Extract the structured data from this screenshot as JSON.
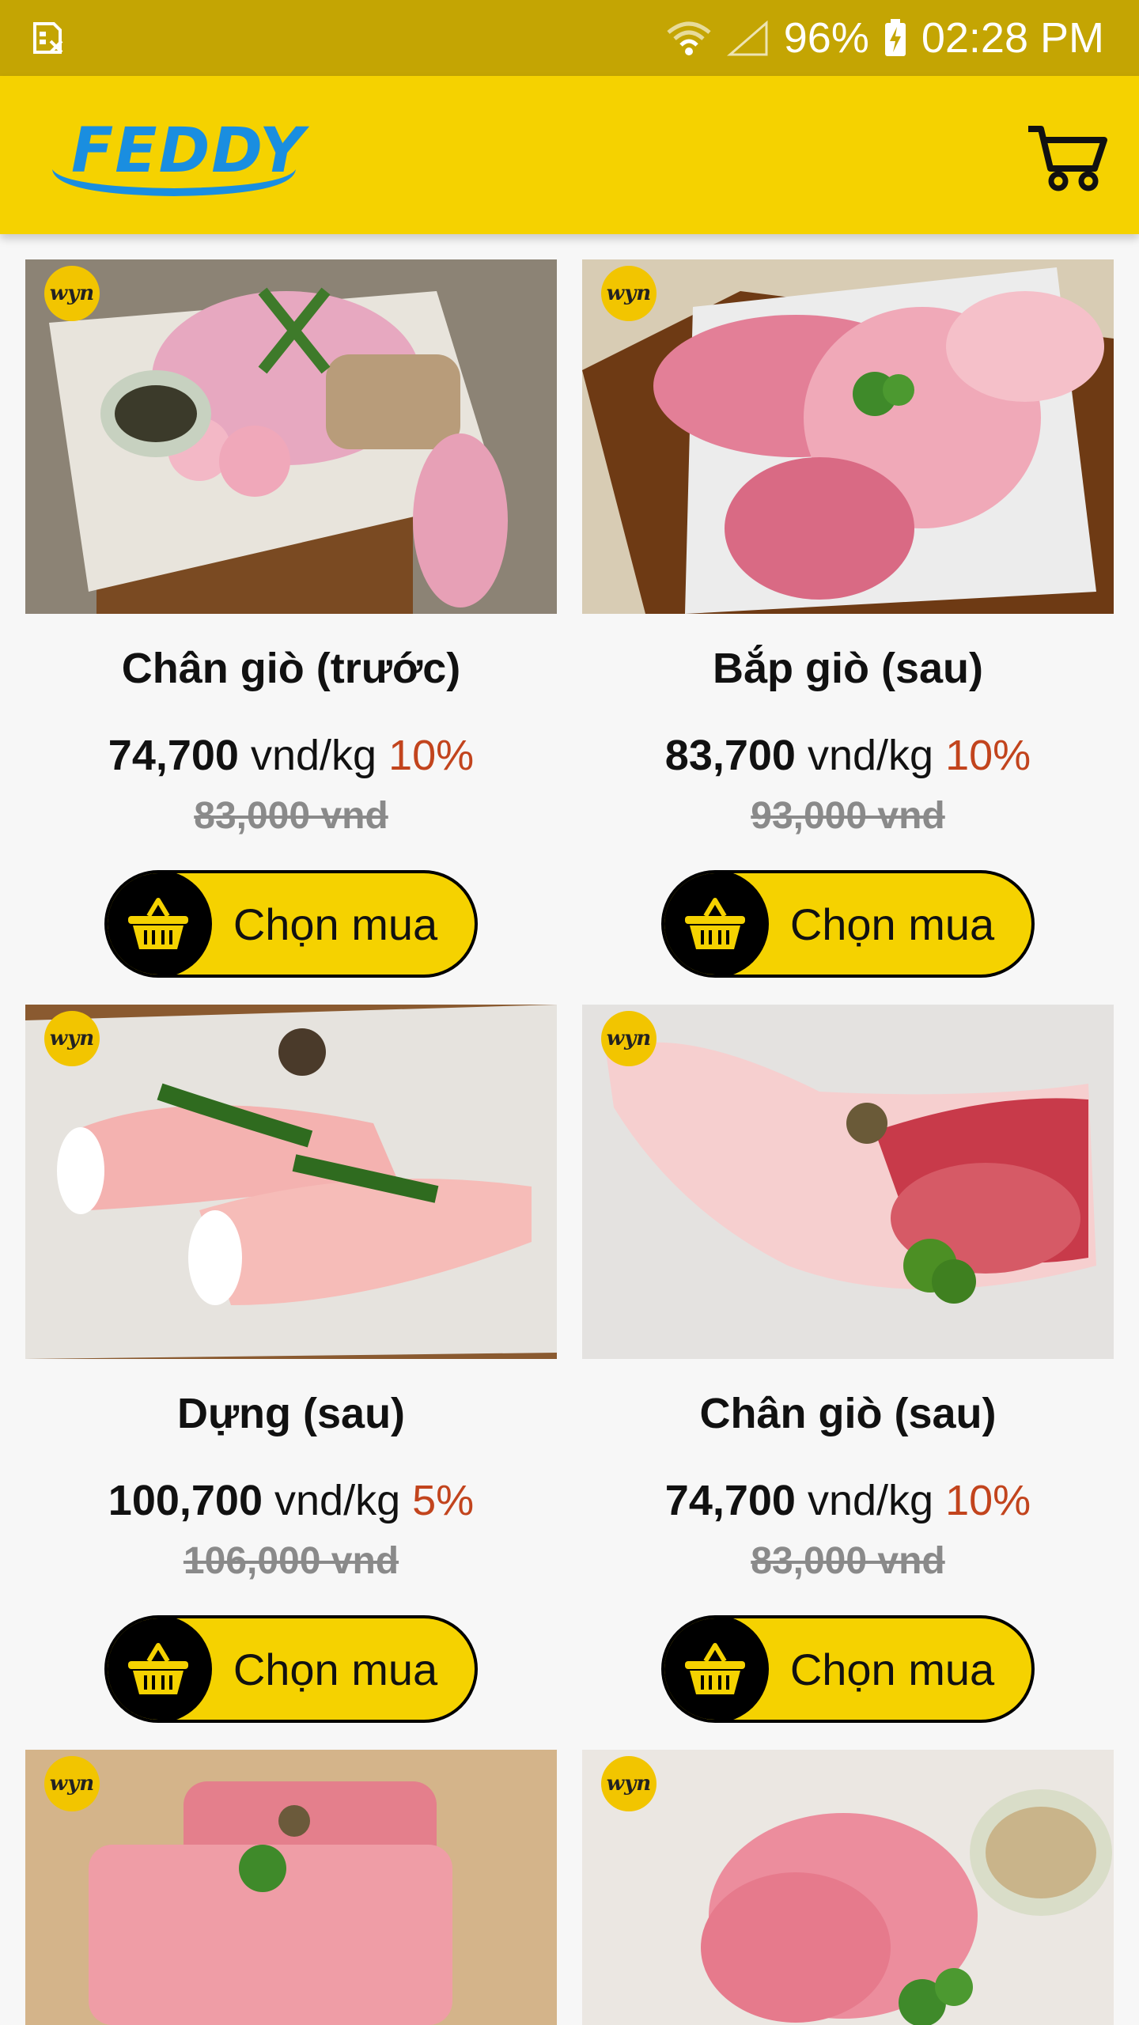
{
  "status_bar": {
    "battery": "96%",
    "time": "02:28 PM"
  },
  "app_bar": {
    "logo_text": "FEDDY",
    "cart_icon": "cart-icon"
  },
  "colors": {
    "status_bar": "#c4a503",
    "app_bar": "#f5d200",
    "logo_blue": "#1a8ee0",
    "discount_red": "#c2441d"
  },
  "products": [
    {
      "name": "Chân giò (trước)",
      "price": "74,700",
      "unit": "vnd/kg",
      "discount": "10%",
      "old_price": "83,000 vnd",
      "button_label": "Chọn mua",
      "badge": "wyn",
      "image": "pork front hock with pepper"
    },
    {
      "name": "Bắp giò (sau)",
      "price": "83,700",
      "unit": "vnd/kg",
      "discount": "10%",
      "old_price": "93,000 vnd",
      "button_label": "Chọn mua",
      "badge": "wyn",
      "image": "pork shank on cutting board"
    },
    {
      "name": "Dựng (sau)",
      "price": "100,700",
      "unit": "vnd/kg",
      "discount": "5%",
      "old_price": "106,000 vnd",
      "button_label": "Chọn mua",
      "badge": "wyn",
      "image": "pork trotters with green pepper"
    },
    {
      "name": "Chân giò (sau)",
      "price": "74,700",
      "unit": "vnd/kg",
      "discount": "10%",
      "old_price": "83,000 vnd",
      "button_label": "Chọn mua",
      "badge": "wyn",
      "image": "pork rear hock"
    },
    {
      "name": "",
      "price": "",
      "unit": "",
      "discount": "",
      "old_price": "",
      "button_label": "",
      "badge": "wyn",
      "image": "pork loin"
    },
    {
      "name": "",
      "price": "",
      "unit": "",
      "discount": "",
      "old_price": "",
      "button_label": "",
      "badge": "wyn",
      "image": "pork tenderloin with peppercorns"
    }
  ]
}
